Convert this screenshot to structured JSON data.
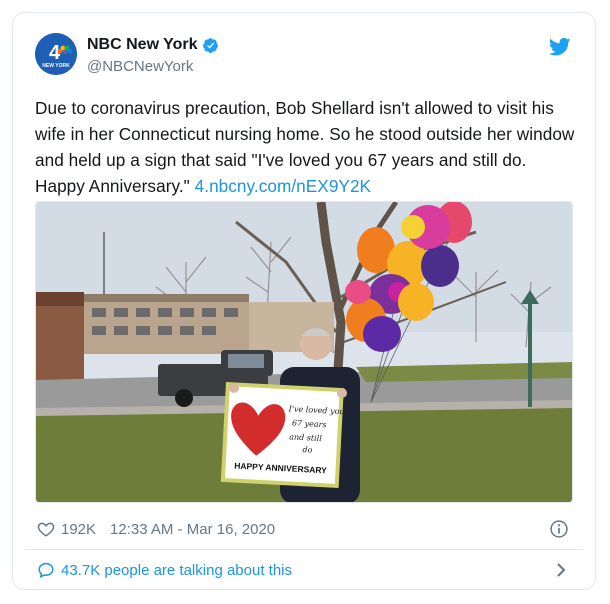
{
  "tweet": {
    "display_name": "NBC New York",
    "handle": "@NBCNewYork",
    "avatar_text": "4",
    "avatar_subtext": "NEW YORK",
    "text": "Due to coronavirus precaution, Bob Shellard isn't allowed to visit his wife in her Connecticut nursing home. So he stood outside her window and held up a sign that said \"I've loved you 67 years and still do. Happy Anniversary.\" ",
    "link": "4.nbcny.com/nEX9Y2K",
    "likes": "192K",
    "timestamp": "12:33 AM - Mar 16, 2020",
    "talking": "43.7K people are talking about this"
  },
  "sign": {
    "line1": "I've loved you",
    "line2": "67 years",
    "line3": "and still",
    "line4": "do",
    "line5": "HAPPY ANNIVERSARY"
  },
  "colors": {
    "link": "#1b95e0",
    "muted": "#657786",
    "verified": "#1da1f2",
    "avatar_bg": "#1e5eb4"
  },
  "icons": [
    "verified-badge-icon",
    "twitter-bird-icon",
    "heart-icon",
    "info-icon",
    "chat-bubble-icon",
    "chevron-right-icon"
  ]
}
